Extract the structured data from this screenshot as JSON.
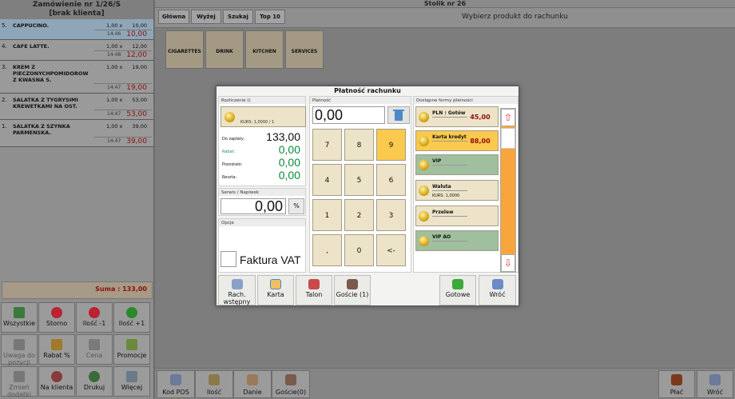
{
  "order": {
    "title": "Zamówienie nr 1/26/S",
    "client": "[brak klienta]",
    "items": [
      {
        "num": "5.",
        "name": "CAPPUCINO.",
        "qty": "1,00 x",
        "price": "10,00",
        "time": "14:46",
        "total": "10,00"
      },
      {
        "num": "4.",
        "name": "CAFE LATTE.",
        "qty": "1,00 x",
        "price": "12,00",
        "time": "14:48",
        "total": "12,00"
      },
      {
        "num": "3.",
        "name": "KREM Z PIECZONYCHPOMIDOROW Z KWASNA S.",
        "qty": "1,00 x",
        "price": "19,00",
        "time": "14:47",
        "total": "19,00"
      },
      {
        "num": "2.",
        "name": "SALATKA Z TYGRYSIMI KREWETKAMI NA OST.",
        "qty": "1,00 x",
        "price": "53,00",
        "time": "14:47",
        "total": "53,00"
      },
      {
        "num": "1.",
        "name": "SALATKA Z SZYNKA PARMENSKA.",
        "qty": "1,00 x",
        "price": "39,00",
        "time": "14:47",
        "total": "39,00"
      }
    ],
    "sum": "Suma : 133,00"
  },
  "left_buttons": [
    "Wszystkie",
    "Storno",
    "Ilość -1",
    "Ilość +1",
    "Uwaga do pozycji",
    "Rabat %",
    "Cena",
    "Promocje",
    "Zmień dodatki",
    "Na klienta",
    "Drukuj",
    "Więcej"
  ],
  "header": {
    "table": "Stolik nr 26",
    "hint": "Wybierz produkt do rachunku"
  },
  "nav": [
    "Główna",
    "Wyżej",
    "Szukaj",
    "Top 10"
  ],
  "categories": [
    "CIGARETTES",
    "DRINK",
    "KITCHEN",
    "SERVICES"
  ],
  "bottom": [
    "Kod POS",
    "Ilość",
    "Danie",
    "Goście(0)",
    "Płać",
    "Wróć"
  ],
  "dialog": {
    "title": "Płatność rachunku",
    "rozliczenie": {
      "title": "Rozliczenie ()",
      "kurs": "KURS: 1,0000 / 1",
      "do_zaplaty_label": "Do zapłaty:",
      "do_zaplaty": "133,00",
      "rabat_label": "Rabat:",
      "rabat": "0,00",
      "pozostalo_label": "Pozostało:",
      "pozostalo": "0,00",
      "reszta_label": "Reszta:",
      "reszta": "0,00"
    },
    "serwis": {
      "title": "Serwis / Napiwek",
      "value": "0,00",
      "pct": "%"
    },
    "opcje": {
      "title": "Opcje",
      "faktura": "Faktura VAT"
    },
    "platnosc": {
      "title": "Płatność",
      "value": "0,00",
      "keys": [
        "7",
        "8",
        "9",
        "4",
        "5",
        "6",
        "1",
        "2",
        "3",
        ",",
        "0",
        "<-"
      ]
    },
    "formy": {
      "title": "Dostępne formy płatności",
      "items": [
        {
          "label": "PLN : Gotów",
          "value": "45,00",
          "sub": ""
        },
        {
          "label": "Karta kredyt",
          "value": "88,00",
          "sub": ""
        },
        {
          "label": "VIP",
          "value": "",
          "sub": ""
        },
        {
          "label": "Waluta",
          "value": "",
          "sub": "KURS: 1,0000"
        },
        {
          "label": "Przelew",
          "value": "",
          "sub": ""
        },
        {
          "label": "VIP AO",
          "value": "",
          "sub": ""
        }
      ]
    },
    "buttons": [
      "Rach. wstępny",
      "Karta",
      "Talon",
      "Goście (1)",
      "Gotowe",
      "Wróć"
    ]
  }
}
